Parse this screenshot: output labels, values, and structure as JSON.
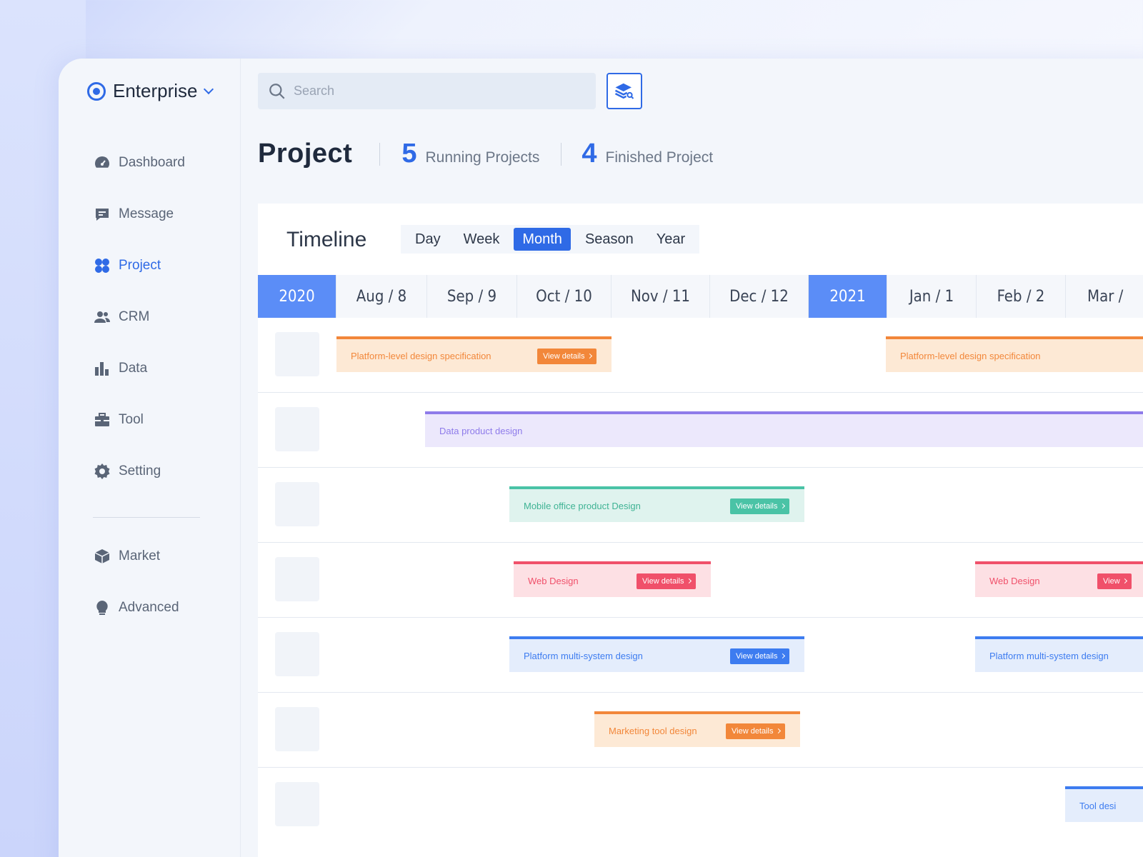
{
  "brand": {
    "label": "Enterprise"
  },
  "sidebar": {
    "items": [
      {
        "label": "Dashboard",
        "icon": "dashboard-icon"
      },
      {
        "label": "Message",
        "icon": "message-icon"
      },
      {
        "label": "Project",
        "icon": "project-icon",
        "active": true
      },
      {
        "label": "CRM",
        "icon": "users-icon"
      },
      {
        "label": "Data",
        "icon": "bar-chart-icon"
      },
      {
        "label": "Tool",
        "icon": "briefcase-icon"
      },
      {
        "label": "Setting",
        "icon": "gear-icon"
      }
    ],
    "secondary": [
      {
        "label": "Market",
        "icon": "cube-icon"
      },
      {
        "label": "Advanced",
        "icon": "lightbulb-icon"
      }
    ]
  },
  "search": {
    "placeholder": "Search"
  },
  "header": {
    "title": "Project",
    "running_count": "5",
    "running_label": "Running Projects",
    "finished_count": "4",
    "finished_label": "Finished Project"
  },
  "timeline": {
    "title": "Timeline",
    "tabs": [
      "Day",
      "Week",
      "Month",
      "Season",
      "Year"
    ],
    "active_tab": "Month",
    "months": [
      "2020",
      "Aug / 8",
      "Sep / 9",
      "Oct / 10",
      "Nov / 11",
      "Dec / 12",
      "2021",
      "Jan / 1",
      "Feb / 2",
      "Mar /"
    ],
    "bars": [
      {
        "title": "Platform-level design specification",
        "button": "View details"
      },
      {
        "title": "Platform-level design specification"
      },
      {
        "title": "Data product design"
      },
      {
        "title": "Mobile office product Design",
        "button": "View details"
      },
      {
        "title": "Web Design",
        "button": "View details"
      },
      {
        "title": "Web Design",
        "button": "View"
      },
      {
        "title": "Platform multi-system design",
        "button": "View details"
      },
      {
        "title": "Platform multi-system design"
      },
      {
        "title": "Marketing tool design",
        "button": "View details"
      },
      {
        "title": "Tool desi"
      }
    ]
  },
  "colors": {
    "accent": "#2f6ae6",
    "orange": "#f2873a",
    "purple": "#8e7bea",
    "teal": "#4ac3a6",
    "red": "#f0506a",
    "blue": "#3d7cf0"
  }
}
